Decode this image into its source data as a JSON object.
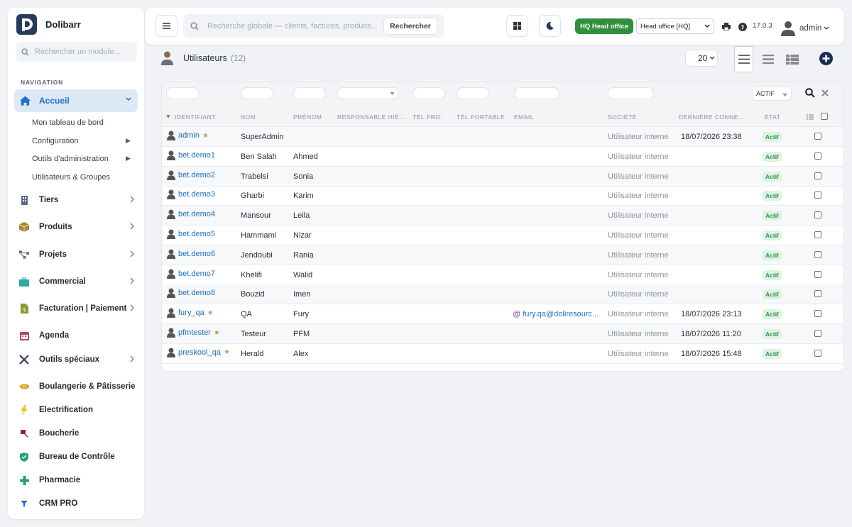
{
  "app": {
    "name": "Dolibarr"
  },
  "sidebar": {
    "search_placeholder": "Rechercher un module...",
    "nav_heading": "NAVIGATION",
    "active": "Accueil",
    "subitems": [
      {
        "label": "Mon tableau de bord"
      },
      {
        "label": "Configuration"
      },
      {
        "label": "Outils d'administration"
      },
      {
        "label": "Utilisateurs & Groupes"
      }
    ],
    "items": [
      {
        "label": "Tiers",
        "icon": "building-icon",
        "color": "#5f6b87"
      },
      {
        "label": "Produits",
        "icon": "cube-icon",
        "color": "#a6862e"
      },
      {
        "label": "Projets",
        "icon": "project-tree-icon",
        "color": "#5f6b87"
      },
      {
        "label": "Commercial",
        "icon": "suitcase-icon",
        "color": "#34a8a0"
      },
      {
        "label": "Facturation | Paiement",
        "icon": "invoice-icon",
        "color": "#8a9a2e"
      },
      {
        "label": "Agenda",
        "icon": "calendar-icon",
        "color": "#b04a6a"
      },
      {
        "label": "Outils spéciaux",
        "icon": "tools-icon",
        "color": "#3b4254"
      },
      {
        "label": "Boulangerie & Pâtisserie",
        "icon": "bread-icon",
        "color": "#d8a21e"
      },
      {
        "label": "Electrification",
        "icon": "bolt-icon",
        "color": "#f2c21b"
      },
      {
        "label": "Boucherie",
        "icon": "meat-icon",
        "color": "#9b1f2d"
      },
      {
        "label": "Bureau de Contrôle",
        "icon": "shield-icon",
        "color": "#25a07a"
      },
      {
        "label": "Pharmacie",
        "icon": "cross-icon",
        "color": "#24a06a"
      },
      {
        "label": "CRM PRO",
        "icon": "funnel-icon",
        "color": "#2a66d1"
      }
    ]
  },
  "topbar": {
    "search_placeholder": "Recherche globale — clients, factures, produits...",
    "search_button": "Rechercher",
    "hq_badge": "HQ Head office",
    "entity": "Head office [HQ]",
    "version": "17.0.3",
    "user": "admin"
  },
  "page": {
    "title": "Utilisateurs",
    "count": "(12)",
    "limit": "20"
  },
  "table": {
    "status_filter": "ACTIF",
    "headers": [
      "IDENTIFIANT",
      "NOM",
      "PRÉNOM",
      "RESPONSABLE HIÉ...",
      "TÉL PRO.",
      "TÉL PORTABLE",
      "EMAIL",
      "SOCIÉTÉ",
      "DERNIÈRE CONNE...",
      "ÉTAT"
    ],
    "rows": [
      {
        "login": "admin",
        "nom": "SuperAdmin",
        "prenom": "",
        "email": "",
        "societe": "Utilisateur interne",
        "last": "18/07/2026 23:38",
        "etat": "Actif",
        "star": true
      },
      {
        "login": "bet.demo1",
        "nom": "Ben Salah",
        "prenom": "Ahmed",
        "email": "",
        "societe": "Utilisateur interne",
        "last": "",
        "etat": "Actif",
        "star": false
      },
      {
        "login": "bet.demo2",
        "nom": "Trabelsi",
        "prenom": "Sonia",
        "email": "",
        "societe": "Utilisateur interne",
        "last": "",
        "etat": "Actif",
        "star": false
      },
      {
        "login": "bet.demo3",
        "nom": "Gharbi",
        "prenom": "Karim",
        "email": "",
        "societe": "Utilisateur interne",
        "last": "",
        "etat": "Actif",
        "star": false
      },
      {
        "login": "bet.demo4",
        "nom": "Mansour",
        "prenom": "Leila",
        "email": "",
        "societe": "Utilisateur interne",
        "last": "",
        "etat": "Actif",
        "star": false
      },
      {
        "login": "bet.demo5",
        "nom": "Hammami",
        "prenom": "Nizar",
        "email": "",
        "societe": "Utilisateur interne",
        "last": "",
        "etat": "Actif",
        "star": false
      },
      {
        "login": "bet.demo6",
        "nom": "Jendoubi",
        "prenom": "Rania",
        "email": "",
        "societe": "Utilisateur interne",
        "last": "",
        "etat": "Actif",
        "star": false
      },
      {
        "login": "bet.demo7",
        "nom": "Khelifi",
        "prenom": "Walid",
        "email": "",
        "societe": "Utilisateur interne",
        "last": "",
        "etat": "Actif",
        "star": false
      },
      {
        "login": "bet.demo8",
        "nom": "Bouzid",
        "prenom": "Imen",
        "email": "",
        "societe": "Utilisateur interne",
        "last": "",
        "etat": "Actif",
        "star": false
      },
      {
        "login": "fury_qa",
        "nom": "QA",
        "prenom": "Fury",
        "email": "fury.qa@doliresourc...",
        "societe": "Utilisateur interne",
        "last": "18/07/2026 23:13",
        "etat": "Actif",
        "star": true
      },
      {
        "login": "pfmtester",
        "nom": "Testeur",
        "prenom": "PFM",
        "email": "",
        "societe": "Utilisateur interne",
        "last": "18/07/2026 11:20",
        "etat": "Actif",
        "star": true
      },
      {
        "login": "preskool_qa",
        "nom": "Herald",
        "prenom": "Alex",
        "email": "",
        "societe": "Utilisateur interne",
        "last": "18/07/2026 15:48",
        "etat": "Actif",
        "star": true
      }
    ]
  }
}
